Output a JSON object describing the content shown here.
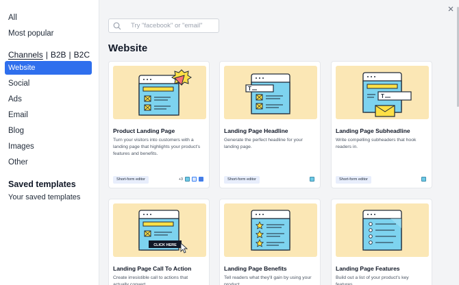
{
  "sidebar": {
    "items_top": [
      "All",
      "Most popular"
    ],
    "channels": {
      "main": "Channels",
      "sub1": "B2B",
      "sub2": "B2C",
      "separator": "|"
    },
    "items": [
      "Website",
      "Social",
      "Ads",
      "Email",
      "Blog",
      "Images",
      "Other"
    ],
    "saved_heading": "Saved templates",
    "saved_item": "Your saved templates"
  },
  "search": {
    "placeholder": "Try \"facebook\" or \"email\""
  },
  "section_title": "Website",
  "cards": [
    {
      "title": "Product Landing Page",
      "desc": "Turn your visitors into customers with a landing page that highlights your product's features and benefits.",
      "tag": "Short-form editor",
      "extra_count": "+3"
    },
    {
      "title": "Landing Page Headline",
      "desc": "Generate the perfect headline for your landing page.",
      "tag": "Short-form editor"
    },
    {
      "title": "Landing Page Subheadline",
      "desc": "Write compelling subheaders that hook readers in.",
      "tag": "Short-form editor"
    },
    {
      "title": "Landing Page Call To Action",
      "desc": "Create irresistible call to actions that actually convert.",
      "illus_text": "CLICK HERE"
    },
    {
      "title": "Landing Page Benefits",
      "desc": "Tell readers what they'll gain by using your product."
    },
    {
      "title": "Landing Page Features",
      "desc": "Build out a list of your product's key features."
    }
  ],
  "colors": {
    "accent": "#2f6fed",
    "illustration_bg": "#fbe7b5",
    "illustration_screen": "#7dd3ef",
    "illustration_badge": "#fde047"
  },
  "icons": [
    "search-icon",
    "close-icon"
  ]
}
